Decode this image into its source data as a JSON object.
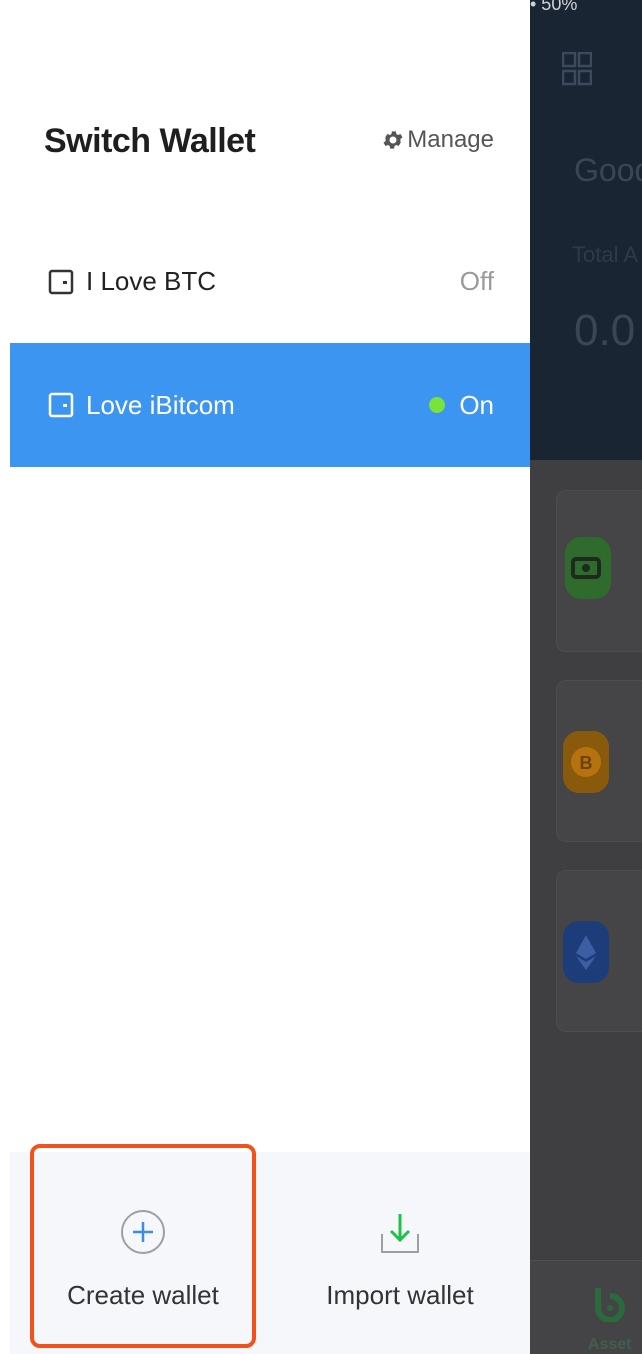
{
  "drawer": {
    "title": "Switch Wallet",
    "manage_label": "Manage",
    "wallets": [
      {
        "name": "I Love BTC",
        "status": "Off",
        "active": false
      },
      {
        "name": "Love iBitcom",
        "status": "On",
        "active": true
      }
    ],
    "actions": {
      "create_label": "Create wallet",
      "import_label": "Import wallet"
    }
  },
  "background_app": {
    "status_text": "• 50%",
    "greeting": "Good",
    "total_label": "Total A",
    "amount": "0.0",
    "nav_label": "Asset"
  },
  "colors": {
    "accent_blue": "#3d95f2",
    "highlight_orange": "#f1511b",
    "online_green": "#7ae33a",
    "import_green": "#1ec14a"
  }
}
